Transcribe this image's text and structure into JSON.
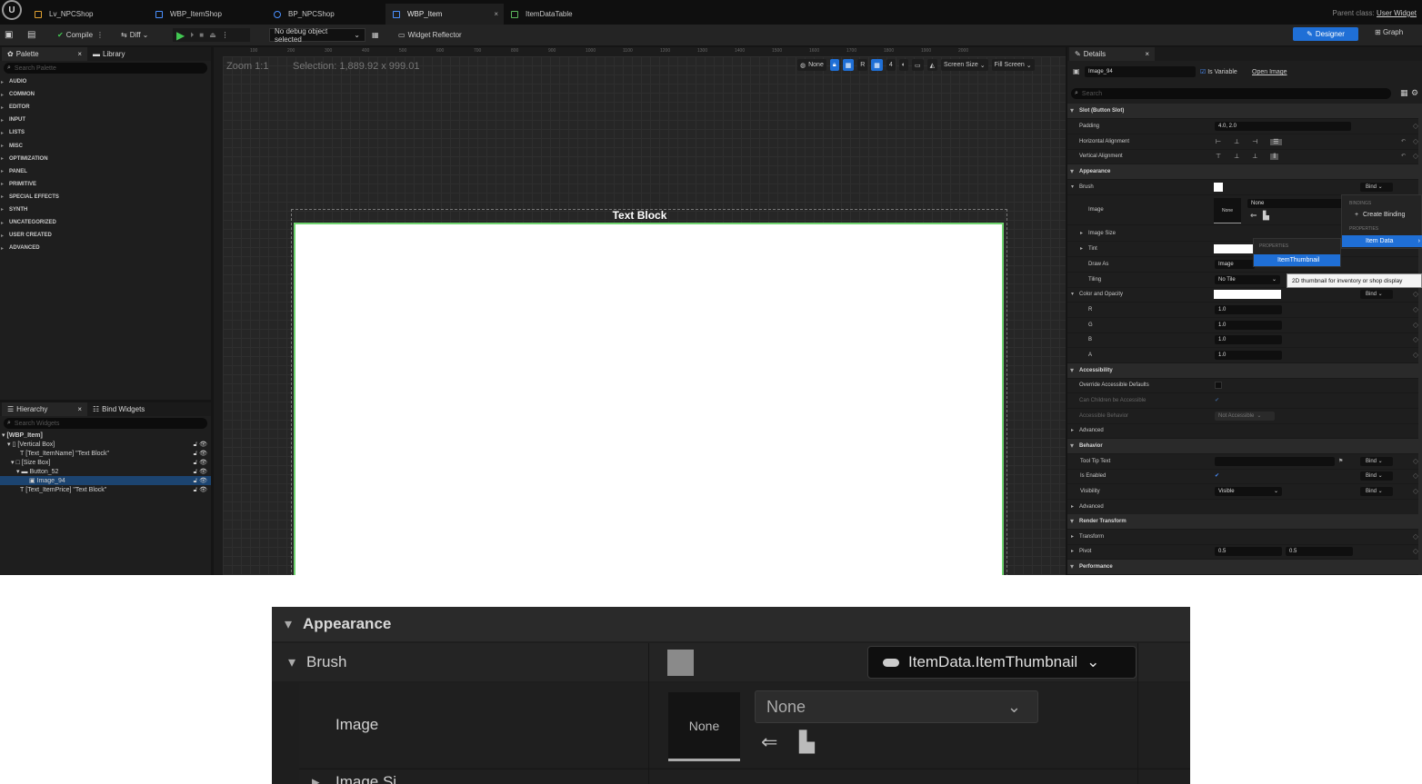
{
  "titlebar": {
    "logo": "U",
    "tabs": [
      {
        "label": "Lv_NPCShop",
        "icon": "level-icon"
      },
      {
        "label": "WBP_ItemShop",
        "icon": "widget-blueprint-icon"
      },
      {
        "label": "BP_NPCShop",
        "icon": "blueprint-icon"
      },
      {
        "label": "WBP_Item",
        "icon": "widget-blueprint-icon",
        "active": true
      },
      {
        "label": "ItemDataTable",
        "icon": "datatable-icon"
      }
    ],
    "tab_close": "×",
    "parent_class_label": "Parent class:",
    "parent_class_value": "User Widget"
  },
  "toolbar": {
    "compile": "Compile",
    "diff": "Diff",
    "debug_select": "No debug object selected",
    "widget_reflector": "Widget Reflector",
    "designer": "Designer",
    "graph": "Graph"
  },
  "palette": {
    "tab": "Palette",
    "library_tab": "Library",
    "search_placeholder": "Search Palette",
    "categories": [
      "AUDIO",
      "COMMON",
      "EDITOR",
      "INPUT",
      "LISTS",
      "MISC",
      "OPTIMIZATION",
      "PANEL",
      "PRIMITIVE",
      "SPECIAL EFFECTS",
      "SYNTH",
      "UNCATEGORIZED",
      "USER CREATED",
      "ADVANCED"
    ]
  },
  "hierarchy": {
    "tab": "Hierarchy",
    "bind_tab": "Bind Widgets",
    "search_placeholder": "Search Widgets",
    "rows": [
      "[WBP_Item]",
      "[Vertical Box]",
      "[Text_ItemName] \"Text Block\"",
      "[Size Box]",
      "Button_52",
      "Image_94",
      "[Text_ItemPrice] \"Text Block\""
    ]
  },
  "viewport": {
    "zoom": "Zoom 1:1",
    "selection": "Selection: 1,889.92 x 999.01",
    "ruler_ticks": [
      "100",
      "200",
      "300",
      "400",
      "500",
      "600",
      "700",
      "800",
      "900",
      "1000",
      "1100",
      "1200",
      "1300",
      "1400",
      "1500",
      "1600",
      "1700",
      "1800",
      "1900",
      "2000"
    ],
    "none_label": "None",
    "r_label": "R",
    "four_label": "4",
    "screen_size": "Screen Size",
    "fill_screen": "Fill Screen",
    "text_block": "Text Block"
  },
  "details": {
    "tab": "Details",
    "widget_name": "Image_94",
    "is_variable": "Is Variable",
    "open_image": "Open Image",
    "search_placeholder": "Search",
    "rows": {
      "slot": "Slot (Button Slot)",
      "padding": "Padding",
      "padding_value": "4.0, 2.0",
      "h_align": "Horizontal Alignment",
      "v_align": "Vertical Alignment",
      "appearance": "Appearance",
      "brush": "Brush",
      "image": "Image",
      "image_size": "Image Size",
      "tint": "Tint",
      "draw_as": "Draw As",
      "draw_as_value": "Image",
      "tiling": "Tiling",
      "tiling_value": "No Tile",
      "color_opacity": "Color and Opacity",
      "r": "R",
      "g": "G",
      "b": "B",
      "a": "A",
      "r_val": "1.0",
      "g_val": "1.0",
      "b_val": "1.0",
      "a_val": "1.0",
      "accessibility": "Accessibility",
      "override_acc": "Override Accessible Defaults",
      "can_children": "Can Children be Accessible",
      "acc_behavior": "Accessible Behavior",
      "acc_behavior_value": "Not Accessible",
      "advanced": "Advanced",
      "behavior": "Behavior",
      "tooltip_text": "Tool Tip Text",
      "is_enabled": "Is Enabled",
      "visibility": "Visibility",
      "visibility_value": "Visible",
      "render_transform": "Render Transform",
      "transform": "Transform",
      "pivot": "Pivot",
      "pivot_x": "0.5",
      "pivot_y": "0.5",
      "performance": "Performance",
      "bind": "Bind",
      "none": "None"
    }
  },
  "popup": {
    "bindings_header": "BINDINGS",
    "create_binding": "Create Binding",
    "properties_header": "PROPERTIES",
    "item_data": "Item Data",
    "item_thumbnail": "ItemThumbnail",
    "tooltip": "2D thumbnail for inventory or shop display"
  },
  "crop": {
    "appearance": "Appearance",
    "brush": "Brush",
    "binding": "ItemData.ItemThumbnail",
    "image": "Image",
    "none_thumb": "None",
    "none_combo": "None",
    "image_size_partial": "Image Si"
  },
  "colors": {
    "accent_blue": "#1f6fd6",
    "selection_green": "#6fd46f",
    "play_green": "#42c752",
    "panel_bg": "#1e1e1e"
  }
}
